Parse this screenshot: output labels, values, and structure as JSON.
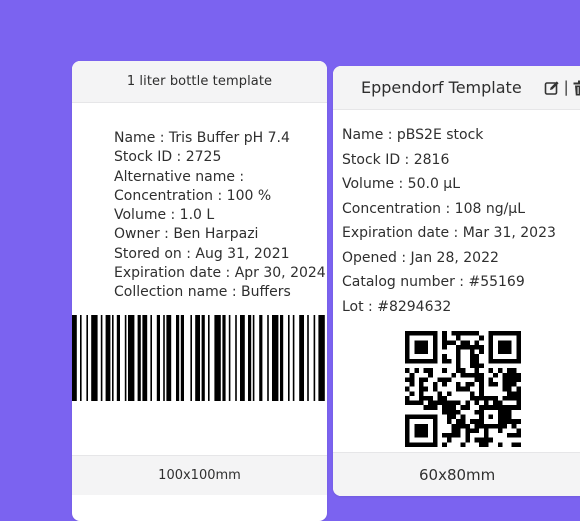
{
  "background_color": "#7b63f0",
  "left_card": {
    "title": "1 liter bottle template",
    "fields": [
      "Name : Tris Buffer pH 7.4",
      "Stock ID : 2725",
      "Alternative name :",
      "Concentration : 100 %",
      "Volume : 1.0 L",
      "Owner : Ben Harpazi",
      "Stored on : Aug 31, 2021",
      "Expiration date : Apr 30, 2024",
      "Collection name : Buffers"
    ],
    "code_type": "barcode",
    "size": "100x100mm"
  },
  "right_card": {
    "title": "Eppendorf Template",
    "icons": [
      "edit-icon",
      "trash-icon"
    ],
    "separator": "|",
    "fields": [
      "Name : pBS2E stock",
      "Stock ID : 2816",
      "Volume : 50.0 µL",
      "Concentration : 108 ng/µL",
      "Expiration date : Mar 31, 2023",
      "Opened : Jan 28, 2022",
      "Catalog number : #55169",
      "Lot : #8294632"
    ],
    "code_type": "qr-code",
    "size": "60x80mm"
  }
}
